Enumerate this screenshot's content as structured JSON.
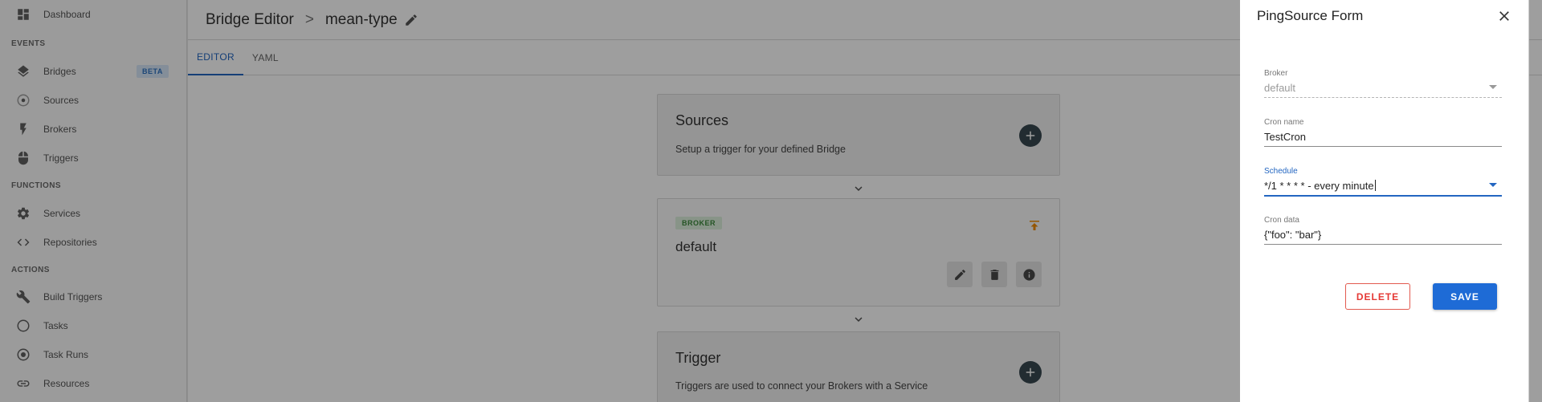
{
  "sidebar": {
    "items": [
      {
        "label": "Dashboard",
        "icon": "dashboard-icon"
      },
      {
        "label": "Bridges",
        "icon": "layers-icon",
        "badge": "BETA"
      },
      {
        "label": "Sources",
        "icon": "source-target-icon"
      },
      {
        "label": "Brokers",
        "icon": "lightning-bolt-icon"
      },
      {
        "label": "Triggers",
        "icon": "mouse-icon"
      },
      {
        "label": "Services",
        "icon": "gear-icon"
      },
      {
        "label": "Repositories",
        "icon": "code-brackets-icon"
      },
      {
        "label": "Build Triggers",
        "icon": "wrench-icon"
      },
      {
        "label": "Tasks",
        "icon": "circle-outline-icon"
      },
      {
        "label": "Task Runs",
        "icon": "radio-target-icon"
      },
      {
        "label": "Resources",
        "icon": "link-icon"
      }
    ],
    "sections": {
      "events": "EVENTS",
      "functions": "FUNCTIONS",
      "actions": "ACTIONS"
    }
  },
  "header": {
    "title": "Bridge Editor",
    "separator": ">",
    "bridge_name": "mean-type"
  },
  "tabs": [
    {
      "label": "EDITOR",
      "active": true
    },
    {
      "label": "YAML",
      "active": false
    }
  ],
  "cards": {
    "sources": {
      "title": "Sources",
      "description": "Setup a trigger for your defined Bridge"
    },
    "broker": {
      "badge": "BROKER",
      "name": "default"
    },
    "trigger": {
      "title": "Trigger",
      "description": "Triggers are used to connect your Brokers with a Service"
    }
  },
  "drawer": {
    "title": "PingSource Form",
    "fields": {
      "broker": {
        "label": "Broker",
        "value": "default"
      },
      "cron_name": {
        "label": "Cron name",
        "value": "TestCron"
      },
      "schedule": {
        "label": "Schedule",
        "value": "*/1 * * * * - every minute"
      },
      "cron_data": {
        "label": "Cron data",
        "value": "{\"foo\": \"bar\"}"
      }
    },
    "delete_label": "DELETE",
    "save_label": "SAVE"
  },
  "colors": {
    "accent": "#2366c1",
    "save_button": "#1e6bd6",
    "delete": "#e53935",
    "broker_badge_text": "#3c8a3c",
    "promote_icon": "#f08c00"
  }
}
